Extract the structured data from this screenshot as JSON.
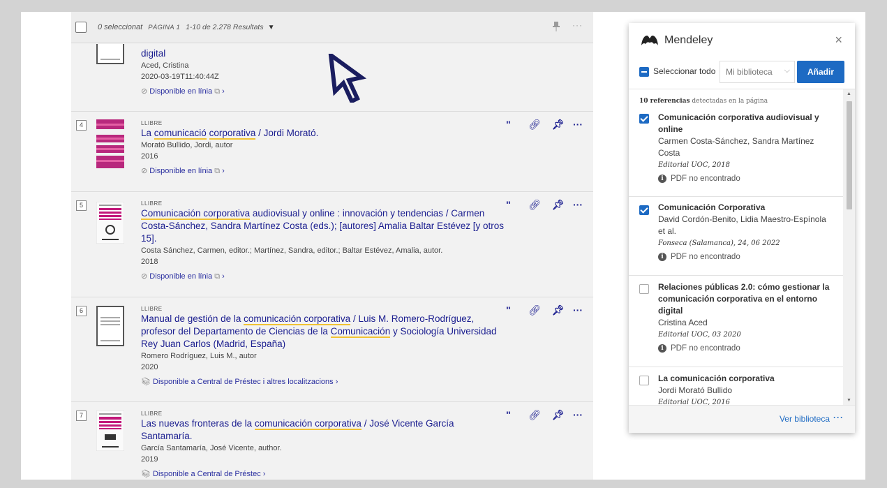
{
  "toolbar": {
    "selected": "0 seleccionat",
    "page": "PÀGINA 1",
    "count": "1-10 de 2.278 Resultats"
  },
  "records": [
    {
      "title_parts": [
        "digital"
      ],
      "meta": [
        "Aced, Cristina",
        "2020-03-19T11:40:44Z"
      ],
      "availability": "Disponible en línia",
      "avail_icons": "⊘ ⍄ ›"
    },
    {
      "number": "4",
      "type": "LLIBRE",
      "title_parts": [
        "La ",
        "comunicació",
        " ",
        "corporativa",
        " / Jordi Morató."
      ],
      "meta": [
        "Morató Bullido, Jordi, autor",
        "2016"
      ],
      "availability": "Disponible en línia"
    },
    {
      "number": "5",
      "type": "LLIBRE",
      "title_parts": [
        "Comunicación corporativa",
        " audiovisual y online : innovación y tendencias / Carmen Costa-Sánchez, Sandra Martínez Costa (eds.); [autores] Amalia Baltar Estévez [y otros 15]."
      ],
      "meta": [
        "Costa Sánchez, Carmen, editor.; Martínez, Sandra, editor.; Baltar Estévez, Amalia, autor.",
        "2018"
      ],
      "availability": "Disponible en línia"
    },
    {
      "number": "6",
      "type": "LLIBRE",
      "title_parts": [
        "Manual de gestión de la ",
        "comunicación corporativa",
        " / Luis M. Romero-Rodríguez, profesor del Departamento de Ciencias de la ",
        "Comunicación",
        " y Sociología Universidad Rey Juan Carlos (Madrid, España)"
      ],
      "meta": [
        "Romero Rodríguez, Luis M., autor",
        "2020"
      ],
      "availability": "Disponible a Central de Préstec i altres localitzacions"
    },
    {
      "number": "7",
      "type": "LLIBRE",
      "title_parts": [
        "Las nuevas fronteras de la ",
        "comunicación corporativa",
        " / José Vicente García Santamaría."
      ],
      "meta": [
        "García Santamaría, José Vicente, author.",
        "2019"
      ],
      "availability": "Disponible a Central de Préstec"
    }
  ],
  "mendeley": {
    "brand": "Mendeley",
    "select_all": "Seleccionar todo",
    "library_select": "Mi biblioteca",
    "add_button": "Añadir",
    "detected_count": "10 referencias",
    "detected_text": " detectadas en la página",
    "references": [
      {
        "checked": true,
        "title": "Comunicación corporativa audiovisual y online",
        "authors": "Carmen Costa-Sánchez, Sandra Martínez Costa",
        "source": "Editorial UOC, 2018",
        "pdf": "PDF no encontrado"
      },
      {
        "checked": true,
        "title": "Comunicación Corporativa",
        "authors": "David Cordón-Benito, Lidia Maestro-Espínola et al.",
        "source": "Fonseca (Salamanca), 24, 06 2022",
        "pdf": "PDF no encontrado"
      },
      {
        "checked": false,
        "title": "Relaciones públicas 2.0: cómo gestionar la comunicación corporativa en el entorno digital",
        "authors": "Cristina Aced",
        "source": "Editorial UOC, 03 2020",
        "pdf": "PDF no encontrado"
      },
      {
        "checked": false,
        "title": "La comunicación corporativa",
        "authors": "Jordi Morató Bullido",
        "source": "Editorial UOC, 2016",
        "pdf": ""
      }
    ],
    "view_library": "Ver biblioteca"
  },
  "icons": {
    "quote": "quote-icon",
    "link": "link-icon",
    "pin": "pin-icon",
    "more": "more-icon"
  }
}
